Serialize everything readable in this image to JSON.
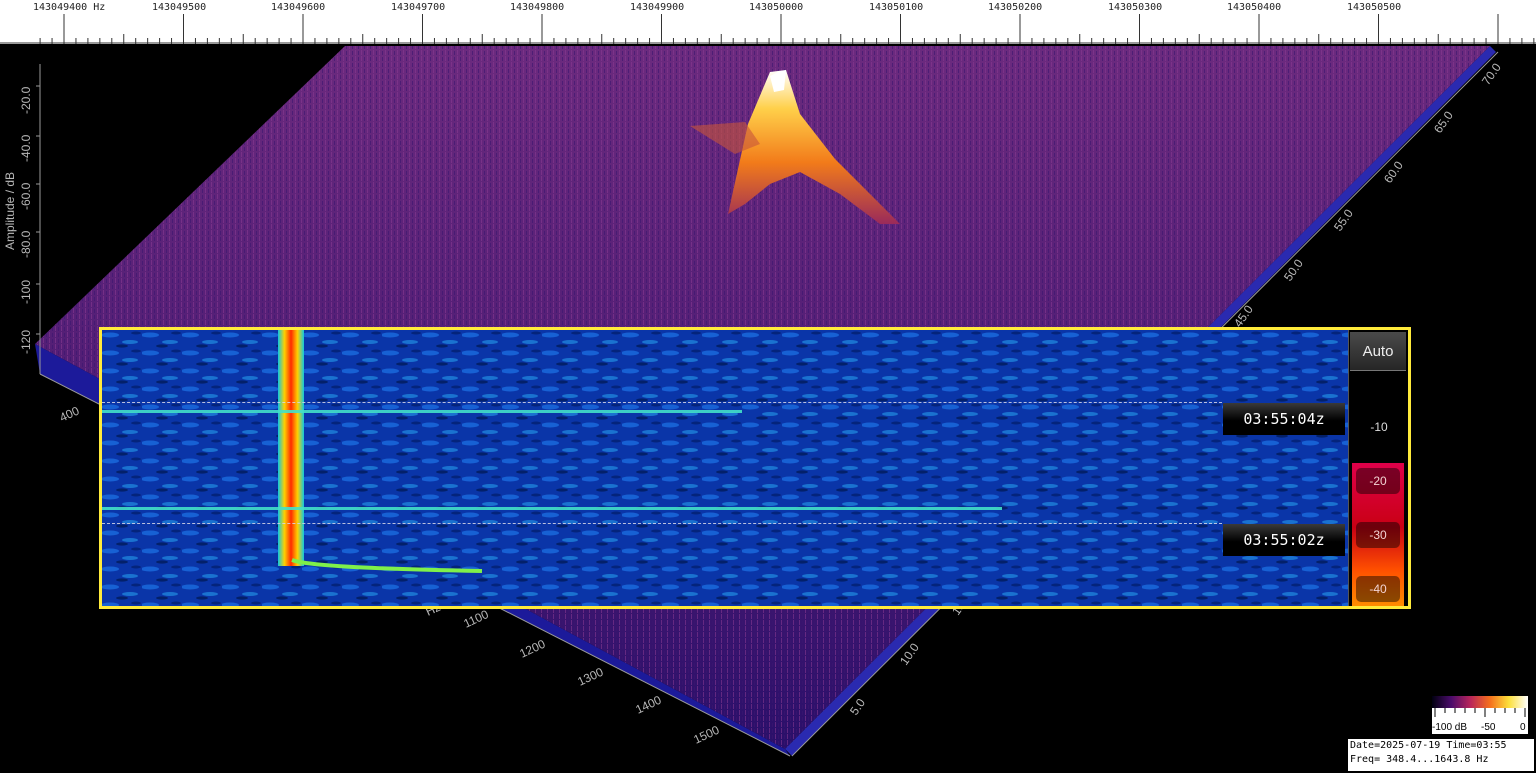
{
  "frequency_ruler": {
    "labels": [
      "143049400 Hz",
      "143049500",
      "143049600",
      "143049700",
      "143049800",
      "143049900",
      "143050000",
      "143050100",
      "143050200",
      "143050300",
      "143050400",
      "143050500"
    ]
  },
  "plot3d": {
    "amplitude_axis_title": "Amplitude / dB",
    "amplitude_ticks": [
      "-20.0",
      "-40.0",
      "-60.0",
      "-80.0",
      "-100",
      "-120"
    ],
    "freq_ticks": [
      "400",
      "1100",
      "1200",
      "1300",
      "1400",
      "1500"
    ],
    "freq_unit_fragment": "Hz",
    "time_ticks": [
      "70.0",
      "65.0",
      "60.0",
      "55.0",
      "50.0",
      "45.0",
      "10.0",
      "5.0"
    ],
    "time_fragment": "15."
  },
  "waterfall": {
    "auto_label": "Auto",
    "scale_labels": [
      "-10",
      "-20",
      "-30",
      "-40"
    ],
    "timestamps": [
      "03:55:04z",
      "03:55:02z"
    ]
  },
  "legend": {
    "labels": [
      "-100 dB",
      "-50",
      "0"
    ]
  },
  "info": {
    "line1": "Date=2025-07-19 Time=03:55",
    "line2": "Freq= 348.4...1643.8 Hz"
  },
  "colors": {
    "waterfall_border": "#ffeb3b",
    "signal": "#ff2a00",
    "noise_floor": "#062a8a",
    "surface": "#5a1a78"
  }
}
